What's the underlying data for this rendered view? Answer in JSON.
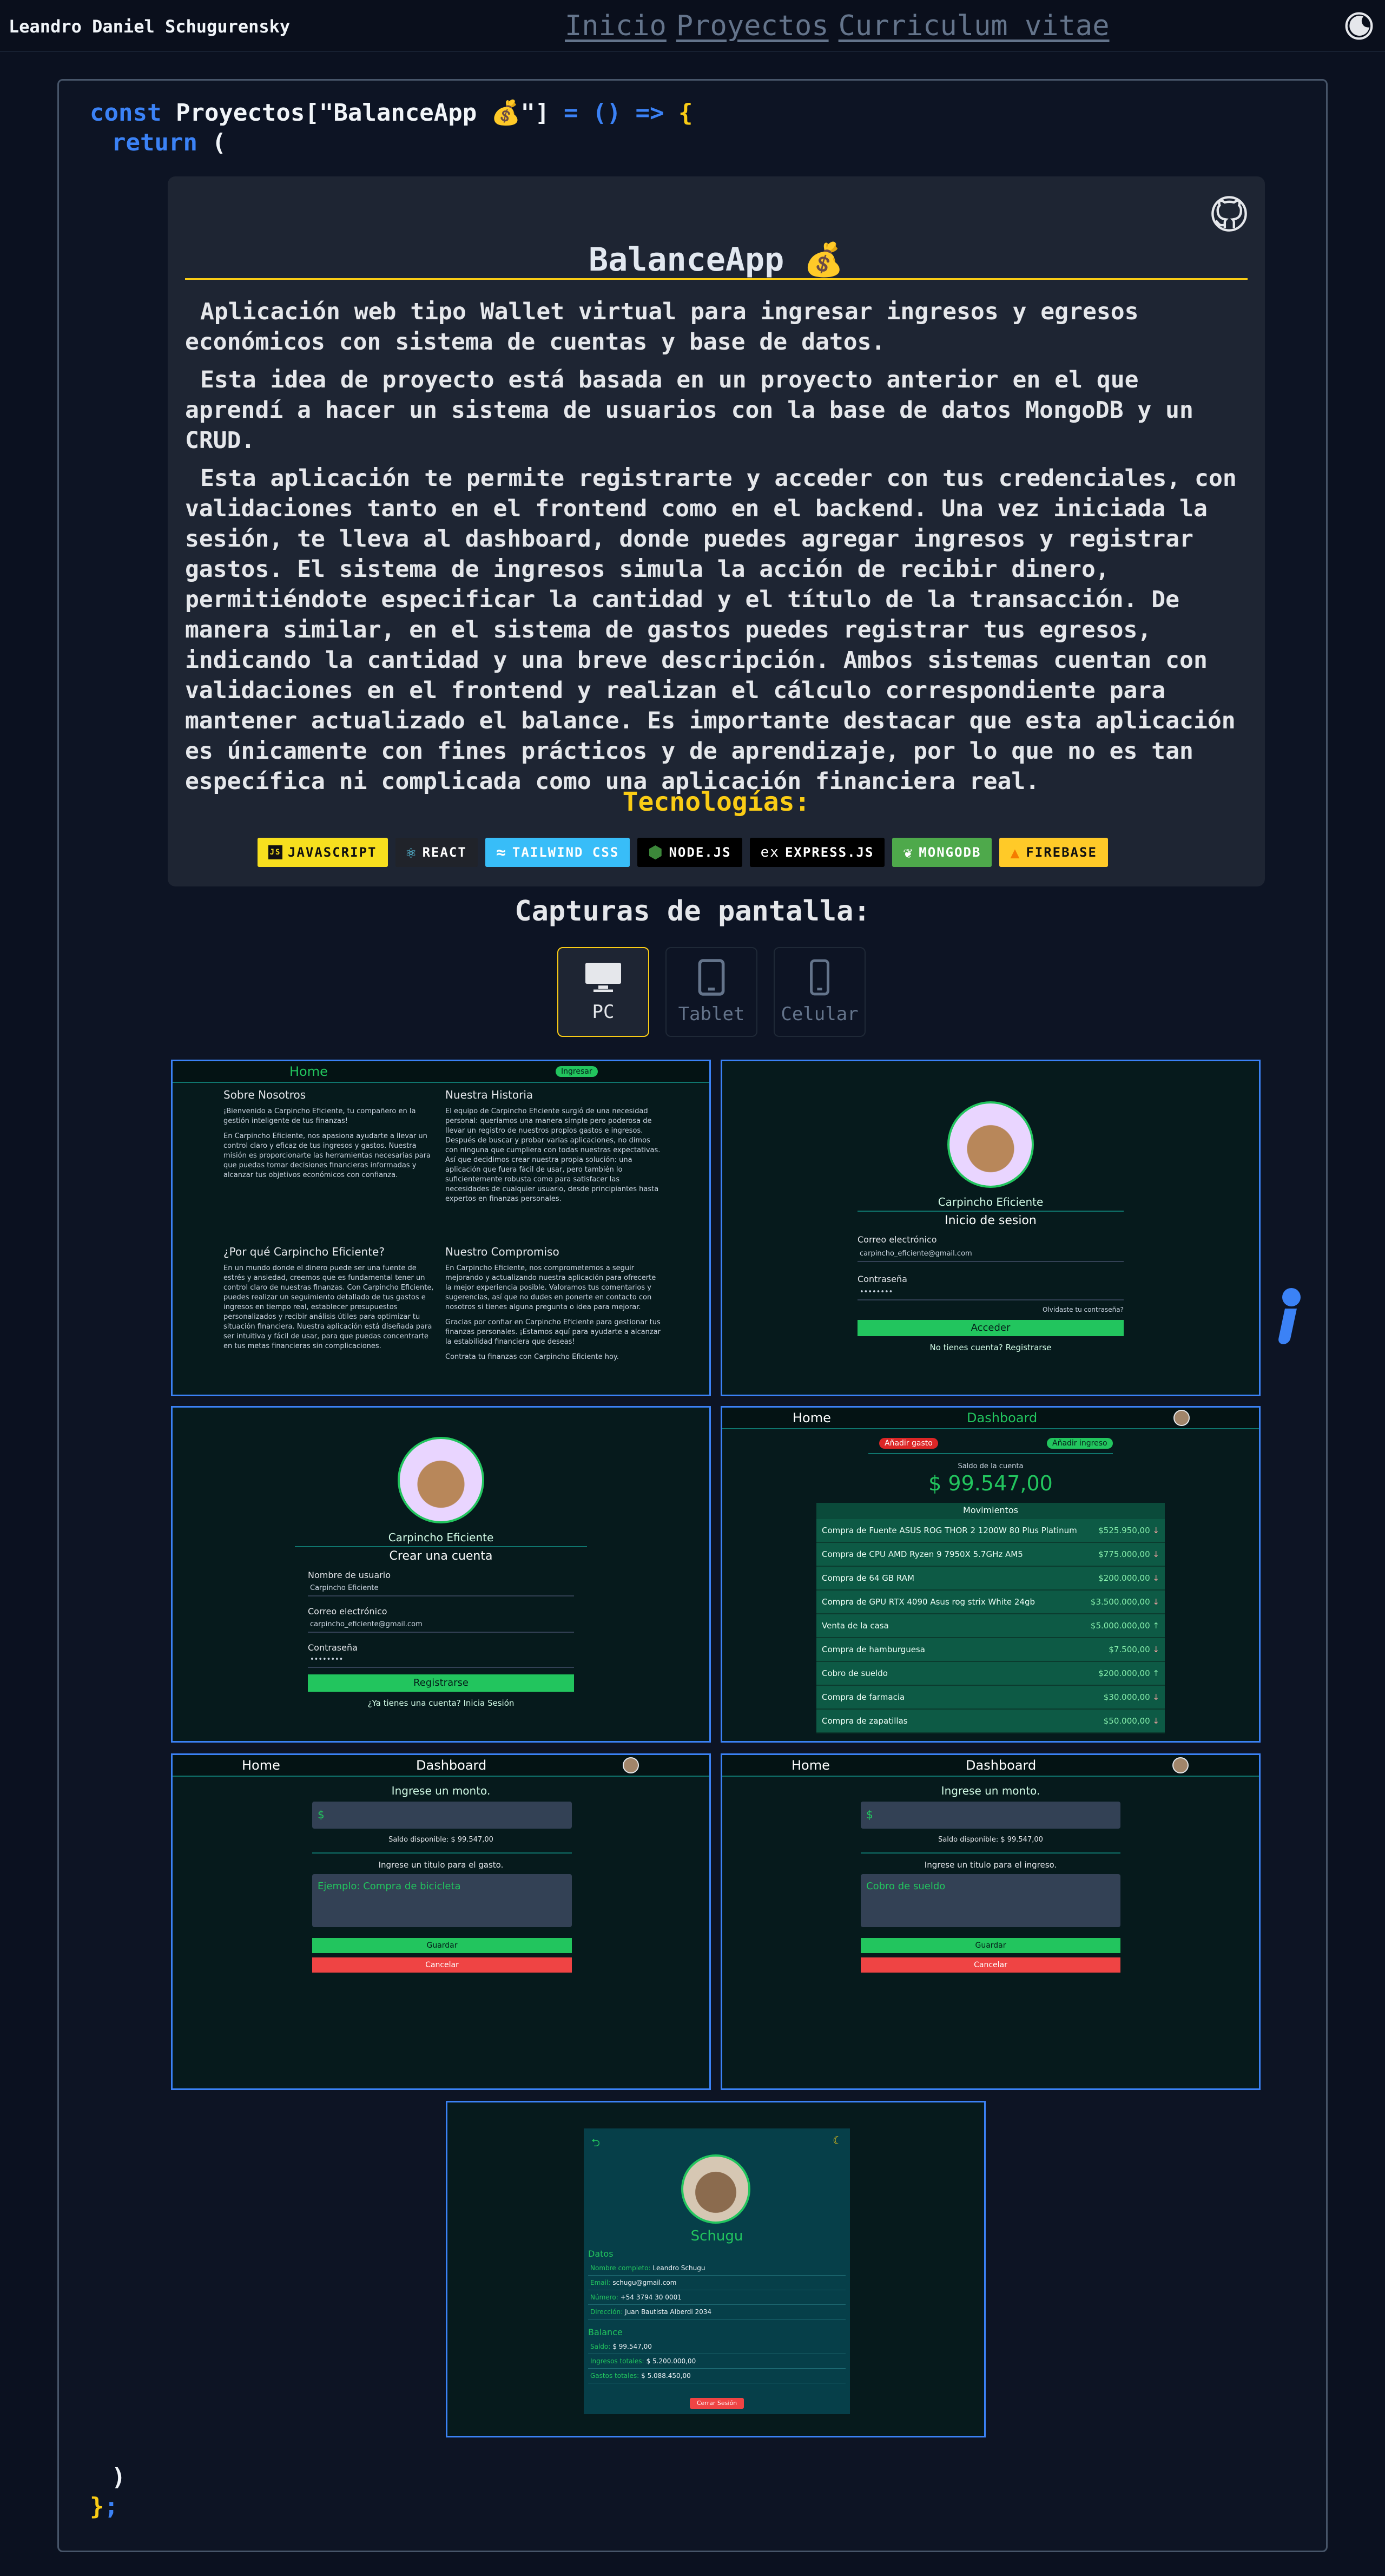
{
  "header": {
    "brand": "Leandro Daniel Schugurensky",
    "nav": [
      "Inicio",
      "Proyectos",
      "Curriculum vitae"
    ],
    "theme_icon": "moon-icon"
  },
  "code": {
    "line1_kw": "const",
    "line1_obj": "Proyectos",
    "line1_key_open": "[\"",
    "line1_key": "BalanceApp 💰",
    "line1_key_close": "\"]",
    "line1_eq": "=",
    "line1_arrow": "() =>",
    "line1_brace": "{",
    "line2_kw": "return",
    "line2_paren": "(",
    "close_paren": ")",
    "close_brace": "}",
    "semicolon": ";"
  },
  "project": {
    "title": "BalanceApp 💰",
    "paragraphs": [
      "Aplicación web tipo Wallet virtual para ingresar ingresos y egresos económicos con sistema de cuentas y base de datos.",
      "Esta idea de proyecto está basada en un proyecto anterior en el que aprendí a hacer un sistema de usuarios con la base de datos MongoDB y un CRUD.",
      "Esta aplicación te permite registrarte y acceder con tus credenciales, con validaciones tanto en el frontend como en el backend. Una vez iniciada la sesión, te lleva al dashboard, donde puedes agregar ingresos y registrar gastos. El sistema de ingresos simula la acción de recibir dinero, permitiéndote especificar la cantidad y el título de la transacción. De manera similar, en el sistema de gastos puedes registrar tus egresos, indicando la cantidad y una breve descripción. Ambos sistemas cuentan con validaciones en el frontend y realizan el cálculo correspondiente para mantener actualizado el balance. Es importante destacar que esta aplicación es únicamente con fines prácticos y de aprendizaje, por lo que no es tan específica ni complicada como una aplicación financiera real."
    ],
    "tech_title": "Tecnologías:",
    "technologies": [
      "JAVASCRIPT",
      "REACT",
      "TAILWIND CSS",
      "NODE.JS",
      "EXPRESS.JS",
      "MONGODB",
      "FIREBASE"
    ],
    "colors": {
      "accent": "#facc15",
      "frame": "#3b82f6",
      "brand_green": "#22c55e"
    }
  },
  "screenshots": {
    "title": "Capturas de pantalla:",
    "tabs": [
      "PC",
      "Tablet",
      "Celular"
    ],
    "selected": "PC",
    "home": {
      "nav_home": "Home",
      "nav_btn": "Ingresar",
      "col1_h1": "Sobre Nosotros",
      "col1_p1": "¡Bienvenido a Carpincho Eficiente, tu compañero en la gestión inteligente de tus finanzas!",
      "col1_p2": "En Carpincho Eficiente, nos apasiona ayudarte a llevar un control claro y eficaz de tus ingresos y gastos. Nuestra misión es proporcionarte las herramientas necesarias para que puedas tomar decisiones financieras informadas y alcanzar tus objetivos económicos con confianza.",
      "col2_h1": "Nuestra Historia",
      "col2_p1": "El equipo de Carpincho Eficiente surgió de una necesidad personal: queríamos una manera simple pero poderosa de llevar un registro de nuestros propios gastos e ingresos. Después de buscar y probar varias aplicaciones, no dimos con ninguna que cumpliera con todas nuestras expectativas. Así que decidimos crear nuestra propia solución: una aplicación que fuera fácil de usar, pero también lo suficientemente robusta como para satisfacer las necesidades de cualquier usuario, desde principiantes hasta expertos en finanzas personales.",
      "col1_h2": "¿Por qué Carpincho Eficiente?",
      "col1_p3": "En un mundo donde el dinero puede ser una fuente de estrés y ansiedad, creemos que es fundamental tener un control claro de nuestras finanzas. Con Carpincho Eficiente, puedes realizar un seguimiento detallado de tus gastos e ingresos en tiempo real, establecer presupuestos personalizados y recibir análisis útiles para optimizar tu situación financiera. Nuestra aplicación está diseñada para ser intuitiva y fácil de usar, para que puedas concentrarte en tus metas financieras sin complicaciones.",
      "col2_h2": "Nuestro Compromiso",
      "col2_p2": "En Carpincho Eficiente, nos comprometemos a seguir mejorando y actualizando nuestra aplicación para ofrecerte la mejor experiencia posible. Valoramos tus comentarios y sugerencias, así que no dudes en ponerte en contacto con nosotros si tienes alguna pregunta o idea para mejorar.",
      "col2_p3": "Gracias por confiar en Carpincho Eficiente para gestionar tus finanzas personales. ¡Estamos aquí para ayudarte a alcanzar la estabilidad financiera que deseas!",
      "col2_p4": "Contrata tu finanzas con Carpincho Eficiente hoy."
    },
    "login": {
      "app_name": "Carpincho Eficiente",
      "title": "Inicio de sesion",
      "email_label": "Correo electrónico",
      "email_value": "carpincho_eficiente@gmail.com",
      "pass_label": "Contraseña",
      "pass_value": "••••••••",
      "forgot": "Olvidaste tu contraseña?",
      "submit": "Acceder",
      "no_account": "No tienes cuenta?",
      "register_link": "Registrarse"
    },
    "register": {
      "app_name": "Carpincho Eficiente",
      "title": "Crear una cuenta",
      "user_label": "Nombre de usuario",
      "user_value": "Carpincho Eficiente",
      "email_label": "Correo electrónico",
      "email_value": "carpincho_eficiente@gmail.com",
      "pass_label": "Contraseña",
      "pass_value": "••••••••",
      "submit": "Registrarse",
      "has_account": "¿Ya tienes una cuenta?",
      "login_link": "Inicia Sesión"
    },
    "dashboard": {
      "nav_home": "Home",
      "nav_dash": "Dashboard",
      "add_expense": "Añadir gasto",
      "add_income": "Añadir ingreso",
      "balance_label": "Saldo de la cuenta",
      "balance": "$ 99.547,00",
      "movements_title": "Movimientos",
      "movements": [
        {
          "title": "Compra de Fuente ASUS ROG THOR 2 1200W 80 Plus Platinum",
          "amount": "$525.950,00",
          "dir": "down"
        },
        {
          "title": "Compra de CPU AMD Ryzen 9 7950X 5.7GHz AM5",
          "amount": "$775.000,00",
          "dir": "down"
        },
        {
          "title": "Compra de 64 GB RAM",
          "amount": "$200.000,00",
          "dir": "down"
        },
        {
          "title": "Compra de GPU RTX 4090 Asus rog strix White 24gb",
          "amount": "$3.500.000,00",
          "dir": "down"
        },
        {
          "title": "Venta de la casa",
          "amount": "$5.000.000,00",
          "dir": "up"
        },
        {
          "title": "Compra de hamburguesa",
          "amount": "$7.500,00",
          "dir": "down"
        },
        {
          "title": "Cobro de sueldo",
          "amount": "$200.000,00",
          "dir": "up"
        },
        {
          "title": "Compra de farmacia",
          "amount": "$30.000,00",
          "dir": "down"
        },
        {
          "title": "Compra de zapatillas",
          "amount": "$50.000,00",
          "dir": "down"
        }
      ]
    },
    "expense_form": {
      "nav_home": "Home",
      "nav_dash": "Dashboard",
      "amount_label": "Ingrese un monto.",
      "currency": "$",
      "available": "Saldo disponible: $ 99.547,00",
      "title_label": "Ingrese un titulo para el gasto.",
      "title_placeholder": "Ejemplo: Compra de bicicleta",
      "save": "Guardar",
      "cancel": "Cancelar"
    },
    "income_form": {
      "nav_home": "Home",
      "nav_dash": "Dashboard",
      "amount_label": "Ingrese un monto.",
      "currency": "$",
      "available": "Saldo disponible: $ 99.547,00",
      "title_label": "Ingrese un titulo para el ingreso.",
      "title_placeholder": "Cobro de sueldo",
      "save": "Guardar",
      "cancel": "Cancelar"
    },
    "profile": {
      "name": "Schugu",
      "data_title": "Datos",
      "fields": [
        {
          "label": "Nombre completo:",
          "value": "Leandro Schugu"
        },
        {
          "label": "Email:",
          "value": "schugu@gmail.com"
        },
        {
          "label": "Número:",
          "value": "+54 3794 30 0001"
        },
        {
          "label": "Dirección:",
          "value": "Juan Bautista Alberdi 2034"
        }
      ],
      "balance_title": "Balance",
      "balance_fields": [
        {
          "label": "Saldo:",
          "value": "$ 99.547,00"
        },
        {
          "label": "Ingresos totales:",
          "value": "$ 5.200.000,00"
        },
        {
          "label": "Gastos totales:",
          "value": "$ 5.088.450,00"
        }
      ],
      "logout": "Cerrar Sesión"
    }
  }
}
